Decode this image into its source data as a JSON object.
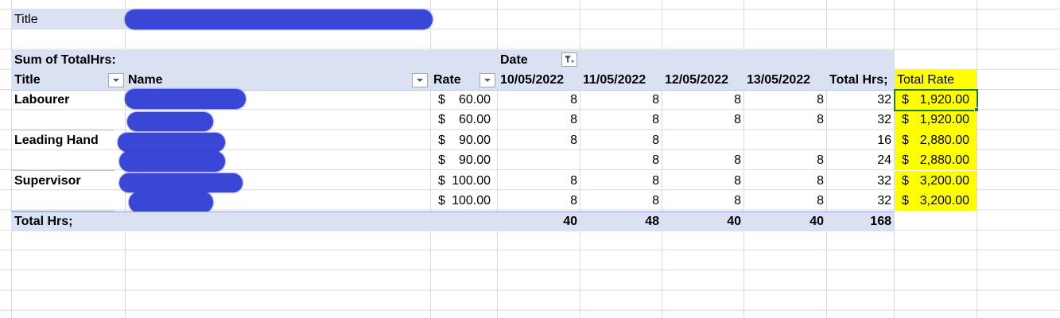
{
  "header": {
    "title_label": "Title"
  },
  "pivot": {
    "value_field": "Sum of TotalHrs:",
    "column_field": "Date",
    "headers": {
      "title": "Title",
      "name": "Name",
      "rate": "Rate",
      "dates": [
        "10/05/2022",
        "11/05/2022",
        "12/05/2022",
        "13/05/2022"
      ],
      "total": "Total Hrs;",
      "total_rate": "Total Rate"
    },
    "rows": [
      {
        "title": "Labourer",
        "rate_sym": "$",
        "rate": "60.00",
        "d1": "8",
        "d2": "8",
        "d3": "8",
        "d4": "8",
        "total": "32",
        "tr_sym": "$",
        "tr": "1,920.00"
      },
      {
        "title": "",
        "rate_sym": "$",
        "rate": "60.00",
        "d1": "8",
        "d2": "8",
        "d3": "8",
        "d4": "8",
        "total": "32",
        "tr_sym": "$",
        "tr": "1,920.00"
      },
      {
        "title": "Leading Hand",
        "rate_sym": "$",
        "rate": "90.00",
        "d1": "8",
        "d2": "8",
        "d3": "",
        "d4": "",
        "total": "16",
        "tr_sym": "$",
        "tr": "2,880.00"
      },
      {
        "title": "",
        "rate_sym": "$",
        "rate": "90.00",
        "d1": "",
        "d2": "8",
        "d3": "8",
        "d4": "8",
        "total": "24",
        "tr_sym": "$",
        "tr": "2,880.00"
      },
      {
        "title": "Supervisor",
        "rate_sym": "$",
        "rate": "100.00",
        "d1": "8",
        "d2": "8",
        "d3": "8",
        "d4": "8",
        "total": "32",
        "tr_sym": "$",
        "tr": "3,200.00"
      },
      {
        "title": "",
        "rate_sym": "$",
        "rate": "100.00",
        "d1": "8",
        "d2": "8",
        "d3": "8",
        "d4": "8",
        "total": "32",
        "tr_sym": "$",
        "tr": "3,200.00"
      }
    ],
    "grand_total": {
      "label": "Total Hrs;",
      "d1": "40",
      "d2": "48",
      "d3": "40",
      "d4": "40",
      "total": "168"
    }
  },
  "colors": {
    "pivot_band": "#d9e1f2",
    "highlight": "#ffff00",
    "redaction": "#3a46d6",
    "selection": "#217346"
  },
  "icons": {
    "filter_dropdown": "chevron-down-icon",
    "active_filter": "filter-icon"
  }
}
